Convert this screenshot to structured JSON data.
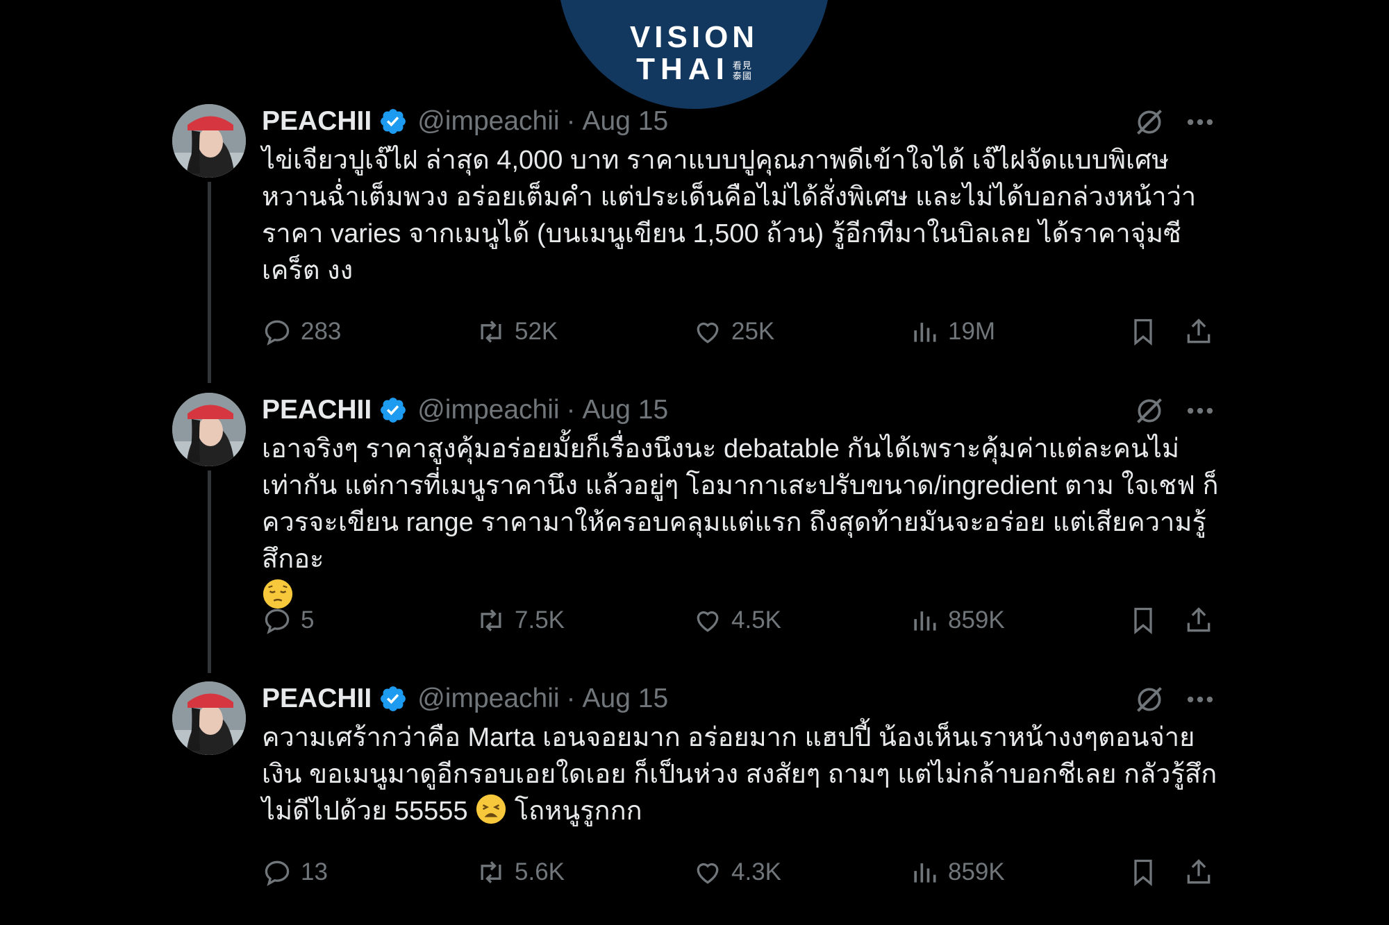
{
  "logo": {
    "line1": "VISION",
    "line2": "THAI",
    "cjk_top": "看見",
    "cjk_bottom": "泰國"
  },
  "tweets": [
    {
      "name": "PEACHII",
      "handle": "@impeachii",
      "separator": "·",
      "date": "Aug 15",
      "text": "ไข่เจียวปูเจ๊ไฝ ล่าสุด 4,000 บาท ราคาแบบปูคุณภาพดีเข้าใจได้ เจ๊ไฝจัดแบบพิเศษ หวานฉ่ำเต็มพวง อร่อยเต็มคำ แต่ประเด็นคือไม่ได้สั่งพิเศษ และไม่ได้บอกล่วงหน้าว่าราคา varies จากเมนูได้ (บนเมนูเขียน 1,500 ถ้วน) รู้อีกทีมาในบิลเลย ได้ราคาจุ่มซีเคร็ต งง",
      "text_after_emoji": "",
      "emoji": "",
      "replies": "283",
      "retweets": "52K",
      "likes": "25K",
      "views": "19M"
    },
    {
      "name": "PEACHII",
      "handle": "@impeachii",
      "separator": "·",
      "date": "Aug 15",
      "text": "เอาจริงๆ ราคาสูงคุ้มอร่อยมั้ยก็เรื่องนึงนะ debatable กันได้เพราะคุ้มค่าแต่ละคนไม่เท่ากัน แต่การที่เมนูราคานึง แล้วอยู่ๆ โอมากาเสะปรับขนาด/ingredient ตาม ใจเชฟ ก็ควรจะเขียน range ราคามาให้ครอบคลุมแต่แรก ถึงสุดท้ายมันจะอร่อย แต่เสียความรู้สึกอะ",
      "text_after_emoji": "",
      "emoji": "pensive-face",
      "replies": "5",
      "retweets": "7.5K",
      "likes": "4.5K",
      "views": "859K"
    },
    {
      "name": "PEACHII",
      "handle": "@impeachii",
      "separator": "·",
      "date": "Aug 15",
      "text": "ความเศร้ากว่าคือ Marta เอนจอยมาก อร่อยมาก แฮปปี้ น้องเห็นเราหน้างงๆตอนจ่ายเงิน ขอเมนูมาดูอีกรอบเอยใดเอย ก็เป็นห่วง สงสัยๆ ถามๆ แต่ไม่กล้าบอกชีเลย กลัวรู้สึกไม่ดีไปด้วย 55555",
      "text_after_emoji": "โถหนูรูกกก",
      "emoji": "weary-face",
      "replies": "13",
      "retweets": "5.6K",
      "likes": "4.3K",
      "views": "859K"
    }
  ],
  "colors": {
    "background": "#000000",
    "text": "#e7e9ea",
    "muted": "#71767b",
    "verified": "#1d9bf0",
    "logo_bg": "#13385f"
  },
  "icons": [
    "verified-badge-icon",
    "grok-icon",
    "more-icon",
    "reply-icon",
    "retweet-icon",
    "like-icon",
    "views-icon",
    "bookmark-icon",
    "share-icon"
  ]
}
